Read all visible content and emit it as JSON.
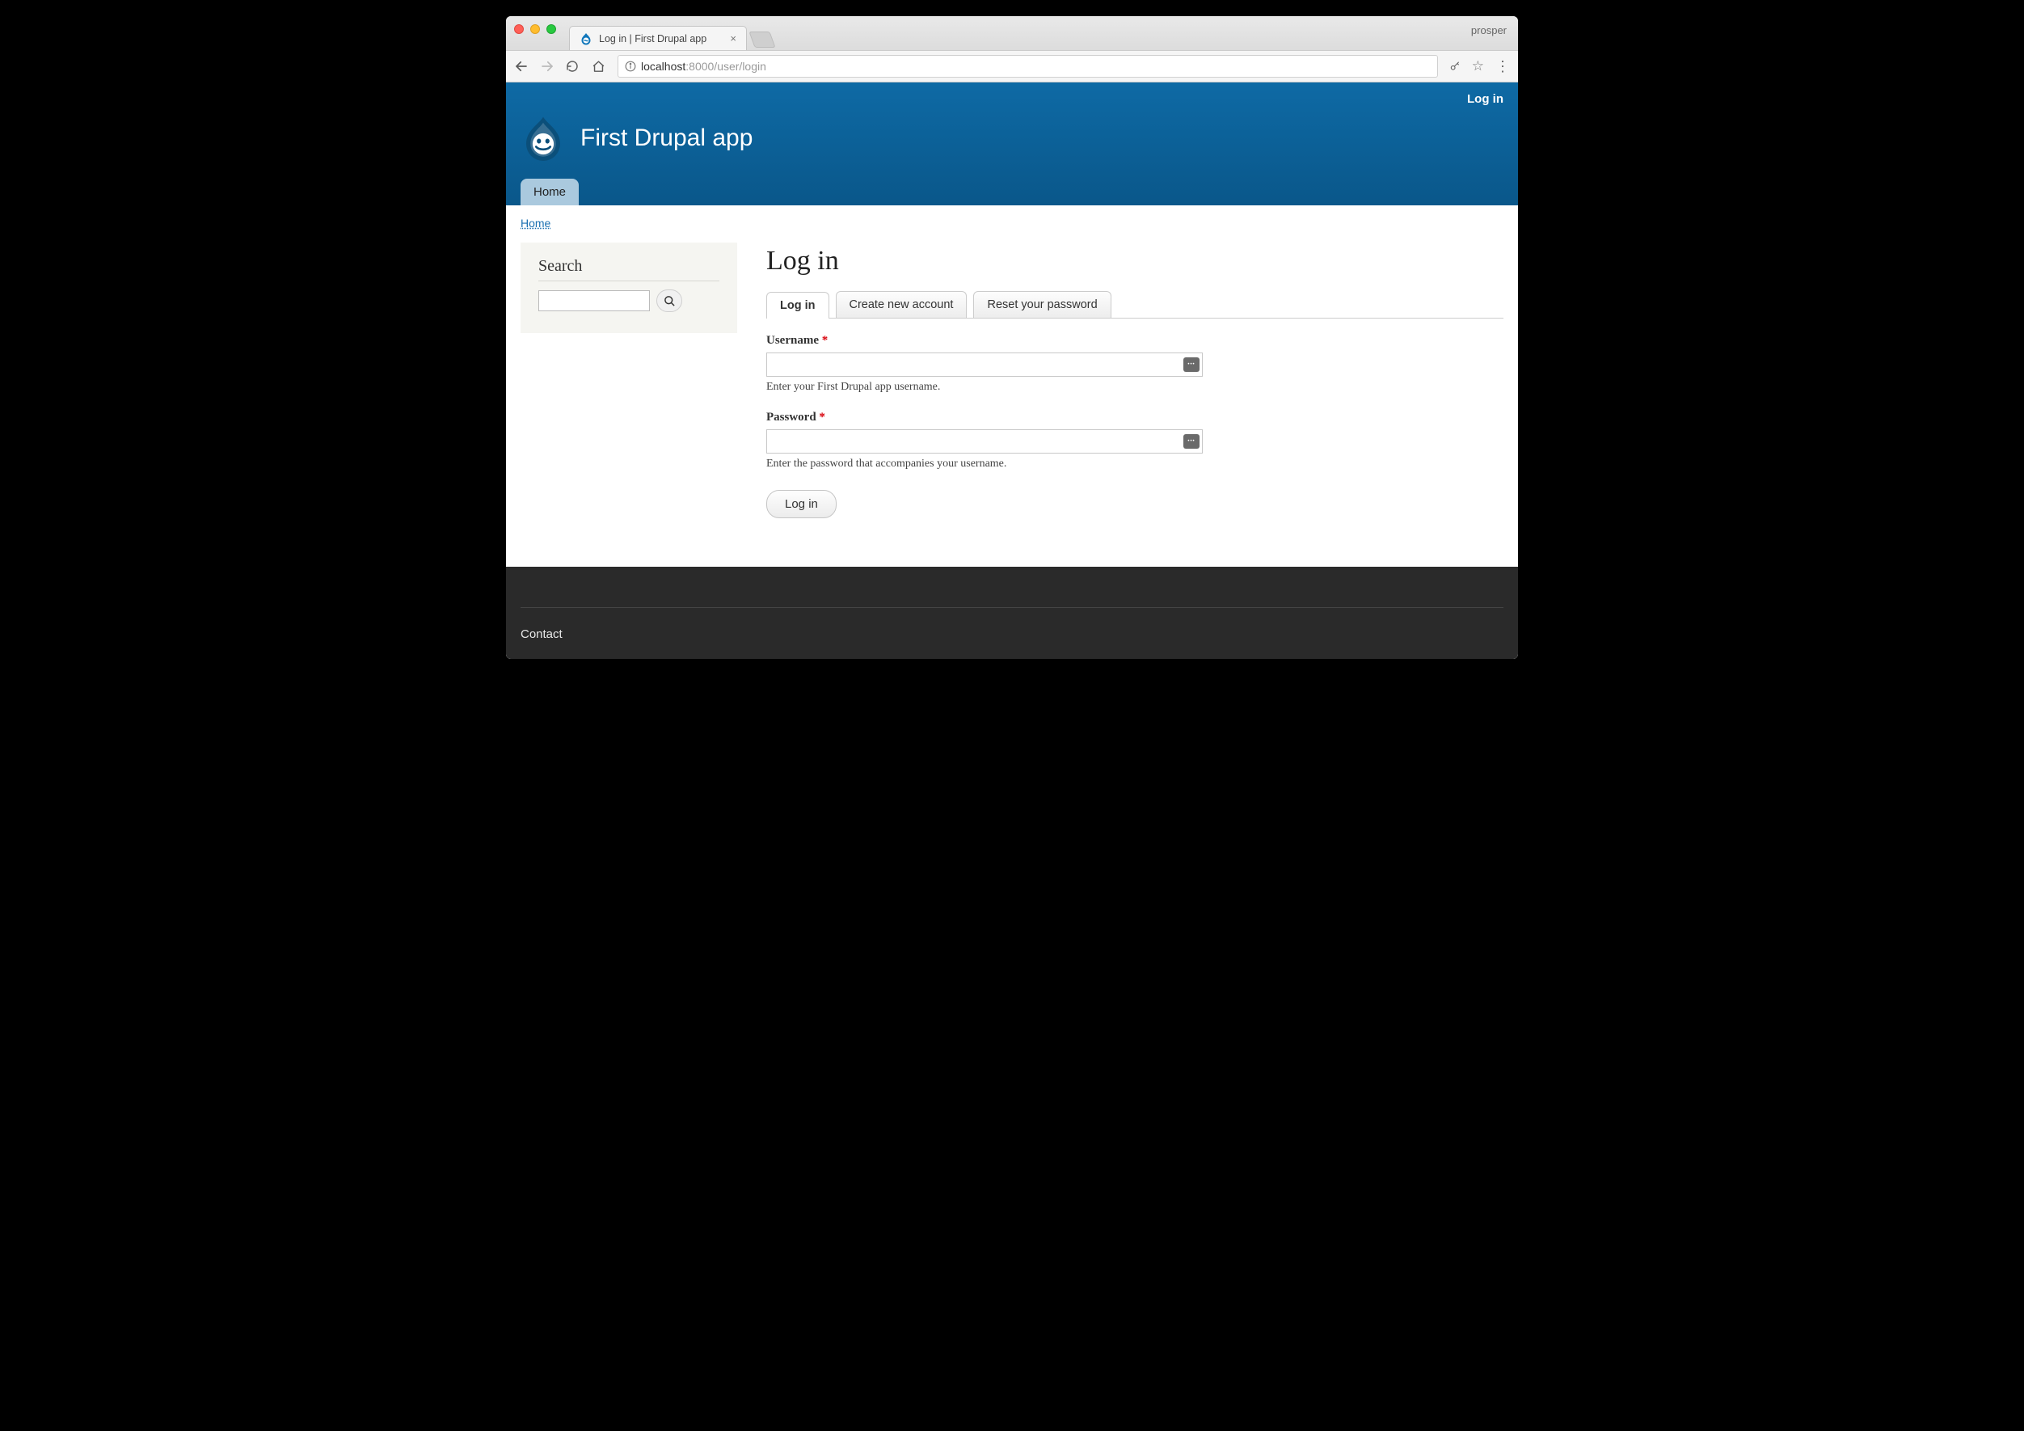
{
  "browser": {
    "profile": "prosper",
    "tab_title": "Log in | First Drupal app",
    "url_prefix": "localhost",
    "url_port_path": ":8000/user/login"
  },
  "header": {
    "top_link": "Log in",
    "site_name": "First Drupal app",
    "nav_home": "Home"
  },
  "breadcrumb": {
    "home": "Home"
  },
  "sidebar": {
    "search_heading": "Search"
  },
  "main": {
    "title": "Log in",
    "tabs": {
      "login": "Log in",
      "create": "Create new account",
      "reset": "Reset your password"
    },
    "form": {
      "username_label": "Username",
      "username_help": "Enter your First Drupal app username.",
      "password_label": "Password",
      "password_help": "Enter the password that accompanies your username.",
      "required_marker": "*",
      "submit": "Log in"
    }
  },
  "footer": {
    "contact": "Contact"
  }
}
